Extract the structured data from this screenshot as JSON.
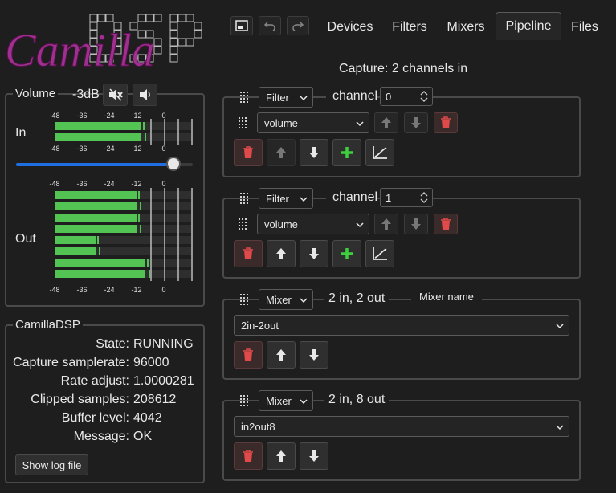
{
  "logo": {
    "script_text": "Camilla",
    "block_text": "DSP"
  },
  "volume_panel": {
    "legend": "Volume",
    "level": "-3dB",
    "mute_icon": "speaker-muted-icon",
    "unmute_icon": "speaker-icon",
    "in_label": "In",
    "out_label": "Out",
    "slider_level_fraction": 0.89,
    "scale_labels": [
      "-48",
      "-36",
      "-24",
      "-12",
      "0"
    ],
    "in_levels_db": [
      -10,
      -10
    ],
    "out_levels_db": [
      -12,
      -12,
      -12,
      -12,
      -30,
      -30,
      -8,
      -8
    ]
  },
  "status_panel": {
    "legend": "CamillaDSP",
    "rows": [
      {
        "key": "State:",
        "value": "RUNNING"
      },
      {
        "key": "Capture samplerate:",
        "value": "96000"
      },
      {
        "key": "Rate adjust:",
        "value": "1.0000281"
      },
      {
        "key": "Clipped samples:",
        "value": "208612"
      },
      {
        "key": "Buffer level:",
        "value": "4042"
      },
      {
        "key": "Message:",
        "value": "OK"
      }
    ],
    "log_button": "Show log file"
  },
  "toolbar": {
    "icons": [
      "fit-screen-icon",
      "undo-icon",
      "redo-icon"
    ]
  },
  "tabs": [
    "Devices",
    "Filters",
    "Mixers",
    "Pipeline",
    "Files"
  ],
  "active_tab": "Pipeline",
  "pipeline": {
    "capture_text": "Capture: 2 channels in",
    "steps": [
      {
        "type": "Filter",
        "channel_label": "channel",
        "channel": "0",
        "filter": "volume"
      },
      {
        "type": "Filter",
        "channel_label": "channel",
        "channel": "1",
        "filter": "volume"
      },
      {
        "type": "Mixer",
        "io": "2 in, 2 out",
        "mixer": "2in-2out"
      },
      {
        "type": "Mixer",
        "io": "2 in, 8 out",
        "mixer": "in2out8"
      }
    ],
    "tooltip": "Mixer name"
  },
  "colors": {
    "meter_green": "#53c453",
    "accent_blue": "#1f6fe0",
    "delete_red": "#e04a4a",
    "add_green": "#3ecf3e",
    "logo_purple": "#a0308f"
  }
}
